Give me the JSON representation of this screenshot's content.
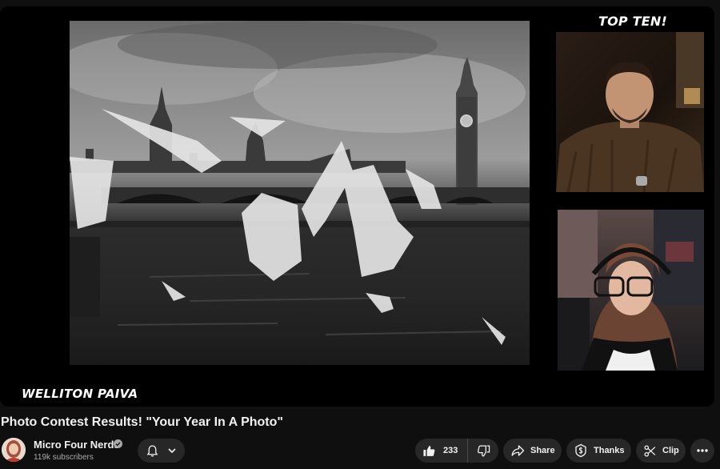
{
  "player": {
    "overlay_top_right": "TOP TEN!",
    "overlay_bottom_left": "WELLITON PAIVA"
  },
  "video": {
    "title": "Photo Contest Results! \"Your Year In A Photo\""
  },
  "channel": {
    "name": "Micro Four Nerds",
    "subscribers": "119k subscribers"
  },
  "actions": {
    "like_count": "233",
    "share_label": "Share",
    "thanks_label": "Thanks",
    "clip_label": "Clip"
  },
  "icons": [
    "verified-check-icon",
    "bell-icon",
    "chevron-down-icon",
    "thumbs-up-icon",
    "thumbs-down-icon",
    "share-arrow-icon",
    "thanks-dollar-icon",
    "scissors-icon",
    "more-dots-icon"
  ],
  "colors": {
    "background": "#0f0f0f",
    "pill": "#272727",
    "text": "#f1f1f1",
    "secondary_text": "#aaaaaa"
  }
}
